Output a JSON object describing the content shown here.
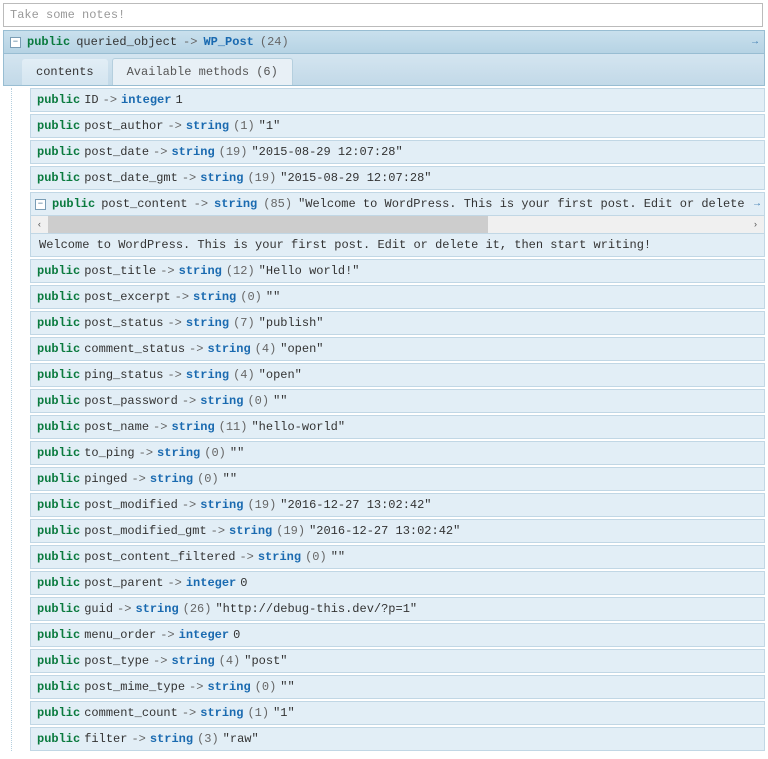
{
  "notes": {
    "placeholder": "Take some notes!"
  },
  "header": {
    "visibility": "public",
    "prop": "queried_object",
    "arrow": "->",
    "type": "WP_Post",
    "count": "(24)",
    "toggle": "−"
  },
  "tabs": {
    "contents": "contents",
    "methods": "Available methods (6)"
  },
  "rows": [
    {
      "vis": "public",
      "name": "ID",
      "arrow": "->",
      "type": "integer",
      "size": "",
      "val": "1"
    },
    {
      "vis": "public",
      "name": "post_author",
      "arrow": "->",
      "type": "string",
      "size": "(1)",
      "val": "\"1\""
    },
    {
      "vis": "public",
      "name": "post_date",
      "arrow": "->",
      "type": "string",
      "size": "(19)",
      "val": "\"2015-08-29 12:07:28\""
    },
    {
      "vis": "public",
      "name": "post_date_gmt",
      "arrow": "->",
      "type": "string",
      "size": "(19)",
      "val": "\"2015-08-29 12:07:28\""
    }
  ],
  "expanded": {
    "toggle": "−",
    "vis": "public",
    "name": "post_content",
    "arrow": "->",
    "type": "string",
    "size": "(85)",
    "val": "\"Welcome to WordPress. This is your first post. Edit or delete",
    "fulltext": "Welcome to WordPress. This is your first post. Edit or delete it, then start writing!",
    "left": "‹",
    "right": "›"
  },
  "rows2": [
    {
      "vis": "public",
      "name": "post_title",
      "arrow": "->",
      "type": "string",
      "size": "(12)",
      "val": "\"Hello world!\""
    },
    {
      "vis": "public",
      "name": "post_excerpt",
      "arrow": "->",
      "type": "string",
      "size": "(0)",
      "val": "\"\""
    },
    {
      "vis": "public",
      "name": "post_status",
      "arrow": "->",
      "type": "string",
      "size": "(7)",
      "val": "\"publish\""
    },
    {
      "vis": "public",
      "name": "comment_status",
      "arrow": "->",
      "type": "string",
      "size": "(4)",
      "val": "\"open\""
    },
    {
      "vis": "public",
      "name": "ping_status",
      "arrow": "->",
      "type": "string",
      "size": "(4)",
      "val": "\"open\""
    },
    {
      "vis": "public",
      "name": "post_password",
      "arrow": "->",
      "type": "string",
      "size": "(0)",
      "val": "\"\""
    },
    {
      "vis": "public",
      "name": "post_name",
      "arrow": "->",
      "type": "string",
      "size": "(11)",
      "val": "\"hello-world\""
    },
    {
      "vis": "public",
      "name": "to_ping",
      "arrow": "->",
      "type": "string",
      "size": "(0)",
      "val": "\"\""
    },
    {
      "vis": "public",
      "name": "pinged",
      "arrow": "->",
      "type": "string",
      "size": "(0)",
      "val": "\"\""
    },
    {
      "vis": "public",
      "name": "post_modified",
      "arrow": "->",
      "type": "string",
      "size": "(19)",
      "val": "\"2016-12-27 13:02:42\""
    },
    {
      "vis": "public",
      "name": "post_modified_gmt",
      "arrow": "->",
      "type": "string",
      "size": "(19)",
      "val": "\"2016-12-27 13:02:42\""
    },
    {
      "vis": "public",
      "name": "post_content_filtered",
      "arrow": "->",
      "type": "string",
      "size": "(0)",
      "val": "\"\""
    },
    {
      "vis": "public",
      "name": "post_parent",
      "arrow": "->",
      "type": "integer",
      "size": "",
      "val": "0"
    },
    {
      "vis": "public",
      "name": "guid",
      "arrow": "->",
      "type": "string",
      "size": "(26)",
      "val": "\"http://debug-this.dev/?p=1\""
    },
    {
      "vis": "public",
      "name": "menu_order",
      "arrow": "->",
      "type": "integer",
      "size": "",
      "val": "0"
    },
    {
      "vis": "public",
      "name": "post_type",
      "arrow": "->",
      "type": "string",
      "size": "(4)",
      "val": "\"post\""
    },
    {
      "vis": "public",
      "name": "post_mime_type",
      "arrow": "->",
      "type": "string",
      "size": "(0)",
      "val": "\"\""
    },
    {
      "vis": "public",
      "name": "comment_count",
      "arrow": "->",
      "type": "string",
      "size": "(1)",
      "val": "\"1\""
    },
    {
      "vis": "public",
      "name": "filter",
      "arrow": "->",
      "type": "string",
      "size": "(3)",
      "val": "\"raw\""
    }
  ]
}
